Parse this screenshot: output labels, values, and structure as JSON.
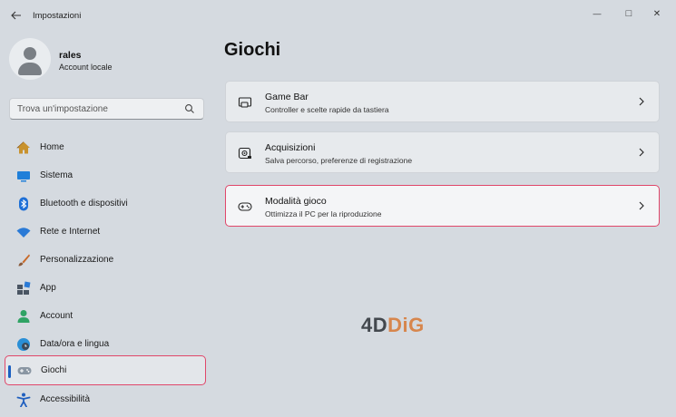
{
  "window": {
    "title": "Impostazioni",
    "controls": {
      "minimize": "—",
      "maximize": "□",
      "close": "✕"
    }
  },
  "user": {
    "name": "rales",
    "account_type": "Account locale"
  },
  "search": {
    "placeholder": "Trova un'impostazione",
    "icon": "search-icon"
  },
  "sidebar": {
    "items": [
      {
        "label": "Home",
        "icon": "home-icon"
      },
      {
        "label": "Sistema",
        "icon": "monitor-icon"
      },
      {
        "label": "Bluetooth e dispositivi",
        "icon": "bluetooth-icon"
      },
      {
        "label": "Rete e Internet",
        "icon": "wifi-icon"
      },
      {
        "label": "Personalizzazione",
        "icon": "brush-icon"
      },
      {
        "label": "App",
        "icon": "apps-icon"
      },
      {
        "label": "Account",
        "icon": "person-icon"
      },
      {
        "label": "Data/ora e lingua",
        "icon": "globe-clock-icon"
      },
      {
        "label": "Giochi",
        "icon": "gamepad-icon",
        "selected": true
      },
      {
        "label": "Accessibilità",
        "icon": "accessibility-icon"
      }
    ]
  },
  "main": {
    "title": "Giochi",
    "cards": [
      {
        "title": "Game Bar",
        "subtitle": "Controller e scelte rapide da tastiera",
        "icon": "game-bar-icon"
      },
      {
        "title": "Acquisizioni",
        "subtitle": "Salva percorso, preferenze di registrazione",
        "icon": "capture-icon"
      },
      {
        "title": "Modalità gioco",
        "subtitle": "Ottimizza il PC per la riproduzione",
        "icon": "game-mode-icon",
        "highlighted": true
      }
    ]
  },
  "watermark": {
    "part1": "4D",
    "part2": "DiG"
  },
  "colors": {
    "background": "#d5dae0",
    "accent": "#1b5fc1",
    "highlight_border": "#e0476a",
    "watermark_orange": "#d7864d"
  }
}
